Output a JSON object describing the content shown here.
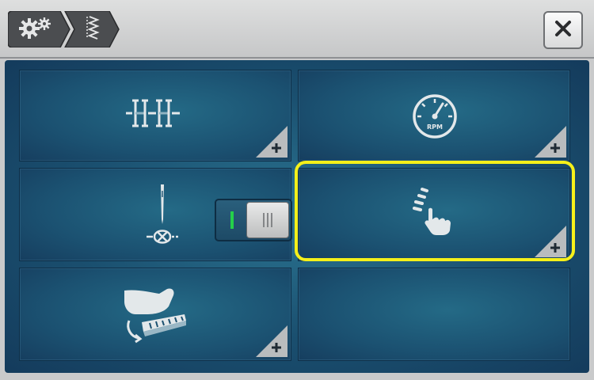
{
  "toolbar": {
    "breadcrumbs": [
      {
        "icon": "gears-icon"
      },
      {
        "icon": "zigzag-stitch-icon"
      }
    ],
    "close_icon": "close-icon"
  },
  "grid": {
    "tiles": [
      {
        "icon": "stitch-width-icon",
        "has_plus": true
      },
      {
        "icon": "speedometer-rpm-icon",
        "label": "RPM",
        "has_plus": true
      },
      {
        "icon": "needle-thread-tie-off-icon",
        "toggle": {
          "state": "off",
          "on_label": "I",
          "off_label": "III"
        },
        "has_plus": false
      },
      {
        "icon": "touch-gesture-icon",
        "has_plus": true,
        "highlighted": true
      },
      {
        "icon": "foot-pedal-icon",
        "has_plus": true
      },
      {
        "icon": "empty-tile",
        "has_plus": false
      }
    ]
  },
  "colors": {
    "highlight": "#f5f01a",
    "toggle_on": "#25d04a",
    "panel": "#1b5171"
  }
}
